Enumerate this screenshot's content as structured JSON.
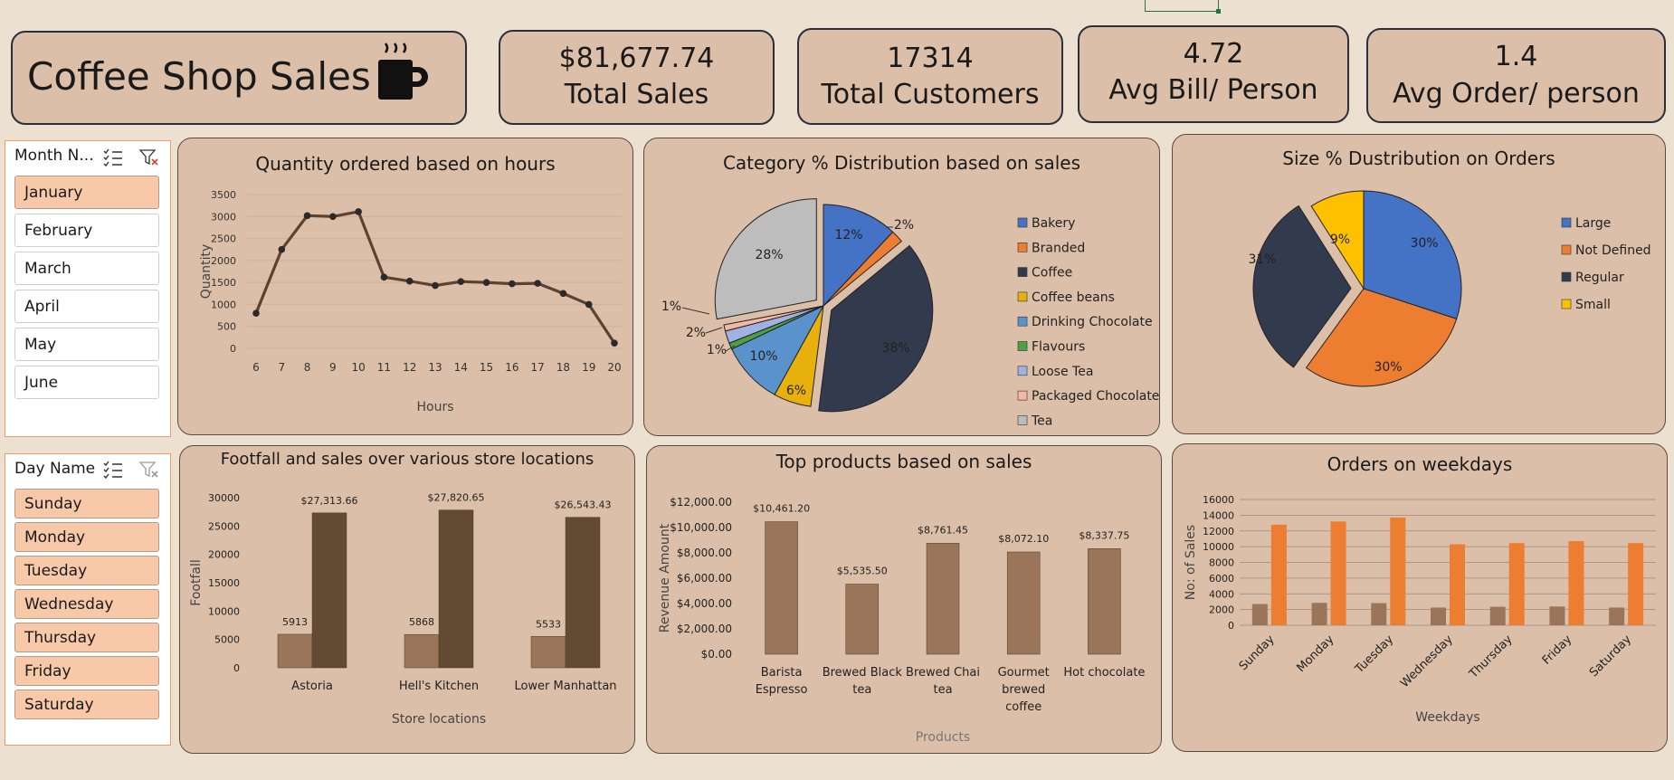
{
  "header": {
    "title": "Coffee Shop Sales",
    "icon": "coffee-cup-icon"
  },
  "kpis": [
    {
      "value": "$81,677.74",
      "label": "Total Sales"
    },
    {
      "value": "17314",
      "label": "Total Customers"
    },
    {
      "value": "4.72",
      "label": "Avg Bill/ Person"
    },
    {
      "value": "1.4",
      "label": "Avg Order/ person"
    }
  ],
  "slicers": {
    "month": {
      "title": "Month N...",
      "items": [
        "January",
        "February",
        "March",
        "April",
        "May",
        "June"
      ],
      "selected": [
        "January"
      ]
    },
    "day": {
      "title": "Day Name",
      "items": [
        "Sunday",
        "Monday",
        "Tuesday",
        "Wednesday",
        "Thursday",
        "Friday",
        "Saturday"
      ],
      "selected": [
        "Sunday",
        "Monday",
        "Tuesday",
        "Wednesday",
        "Thursday",
        "Friday",
        "Saturday"
      ]
    }
  },
  "colors": {
    "background": "#ece0d1",
    "card": "#dbbfa8",
    "line": "#5c4230",
    "bar_light": "#9a755a",
    "bar_dark": "#624a33",
    "orange": "#ed7d31"
  },
  "chart_data": [
    {
      "id": "hours",
      "type": "line",
      "title": "Quantity ordered based on hours",
      "xlabel": "Hours",
      "ylabel": "Quantity",
      "x": [
        6,
        7,
        8,
        9,
        10,
        11,
        12,
        13,
        14,
        15,
        16,
        17,
        18,
        19,
        20
      ],
      "y": [
        800,
        2250,
        3020,
        3000,
        3110,
        1620,
        1530,
        1430,
        1520,
        1500,
        1470,
        1480,
        1250,
        1000,
        120
      ],
      "ylim": [
        0,
        3500
      ],
      "yticks": [
        "0",
        "500",
        "1000",
        "1500",
        "2000",
        "2500",
        "3000",
        "3500"
      ],
      "grid": true
    },
    {
      "id": "category",
      "type": "pie",
      "title": "Category % Distribution based on sales",
      "categories": [
        "Bakery",
        "Branded",
        "Coffee",
        "Coffee beans",
        "Drinking Chocolate",
        "Flavours",
        "Loose Tea",
        "Packaged Chocolate",
        "Tea"
      ],
      "values": [
        12,
        2,
        38,
        6,
        10,
        1,
        2,
        1,
        28
      ],
      "labels": [
        "12%",
        "2%",
        "38%",
        "6%",
        "10%",
        "1%",
        "2%",
        "1%",
        "28%"
      ],
      "colors": [
        "#4472c4",
        "#ed7d31",
        "#323a4e",
        "#e8b00c",
        "#5a93cc",
        "#4ea047",
        "#9fb2e3",
        "#f2b8a0",
        "#bdbdbd"
      ],
      "legend": "right"
    },
    {
      "id": "size",
      "type": "pie",
      "title": "Size % Dustribution on Orders",
      "categories": [
        "Large",
        "Not Defined",
        "Regular",
        "Small"
      ],
      "values": [
        30,
        30,
        31,
        9
      ],
      "labels": [
        "30%",
        "30%",
        "31%",
        "9%"
      ],
      "colors": [
        "#4472c4",
        "#ed7d31",
        "#323a4e",
        "#ffc000"
      ],
      "legend": "right"
    },
    {
      "id": "stores",
      "type": "bar",
      "title": "Footfall and sales over various store locations",
      "xlabel": "Store locations",
      "ylabel": "Footfall",
      "categories": [
        "Astoria",
        "Hell's Kitchen",
        "Lower Manhattan"
      ],
      "series": [
        {
          "values": [
            5913,
            5868,
            5533
          ],
          "labels": [
            "5913",
            "5868",
            "5533"
          ]
        },
        {
          "values": [
            27313.66,
            27820.65,
            26543.43
          ],
          "labels": [
            "$27,313.66",
            "$27,820.65",
            "$26,543.43"
          ]
        }
      ],
      "ylim": [
        0,
        30000
      ],
      "yticks": [
        "0",
        "5000",
        "10000",
        "15000",
        "20000",
        "25000",
        "30000"
      ]
    },
    {
      "id": "products",
      "type": "bar",
      "title": "Top products based on sales",
      "xlabel": "Products",
      "ylabel": "Revenue Amount",
      "categories": [
        "Barista Espresso",
        "Brewed Black tea",
        "Brewed Chai tea",
        "Gourmet brewed coffee",
        "Hot chocolate"
      ],
      "category_lines": [
        [
          "Barista",
          "Espresso"
        ],
        [
          "Brewed Black",
          "tea"
        ],
        [
          "Brewed Chai",
          "tea"
        ],
        [
          "Gourmet",
          "brewed",
          "coffee"
        ],
        [
          "Hot chocolate"
        ]
      ],
      "values": [
        10461.2,
        5535.5,
        8761.45,
        8072.1,
        8337.75
      ],
      "labels": [
        "$10,461.20",
        "$5,535.50",
        "$8,761.45",
        "$8,072.10",
        "$8,337.75"
      ],
      "ylim": [
        0,
        12000
      ],
      "yticks": [
        "$0.00",
        "$2,000.00",
        "$4,000.00",
        "$6,000.00",
        "$8,000.00",
        "$10,000.00",
        "$12,000.00"
      ]
    },
    {
      "id": "weekdays",
      "type": "bar",
      "title": "Orders on weekdays",
      "xlabel": "Weekdays",
      "ylabel": "No: of Sales",
      "categories": [
        "Sunday",
        "Monday",
        "Tuesday",
        "Wednesday",
        "Thursday",
        "Friday",
        "Saturday"
      ],
      "series": [
        {
          "values": [
            2700,
            2850,
            2820,
            2250,
            2350,
            2380,
            2250
          ]
        },
        {
          "values": [
            12800,
            13200,
            13700,
            10300,
            10450,
            10700,
            10450
          ]
        }
      ],
      "ylim": [
        0,
        16000
      ],
      "yticks": [
        "0",
        "2000",
        "4000",
        "6000",
        "8000",
        "10000",
        "12000",
        "14000",
        "16000"
      ],
      "grid": true
    }
  ]
}
